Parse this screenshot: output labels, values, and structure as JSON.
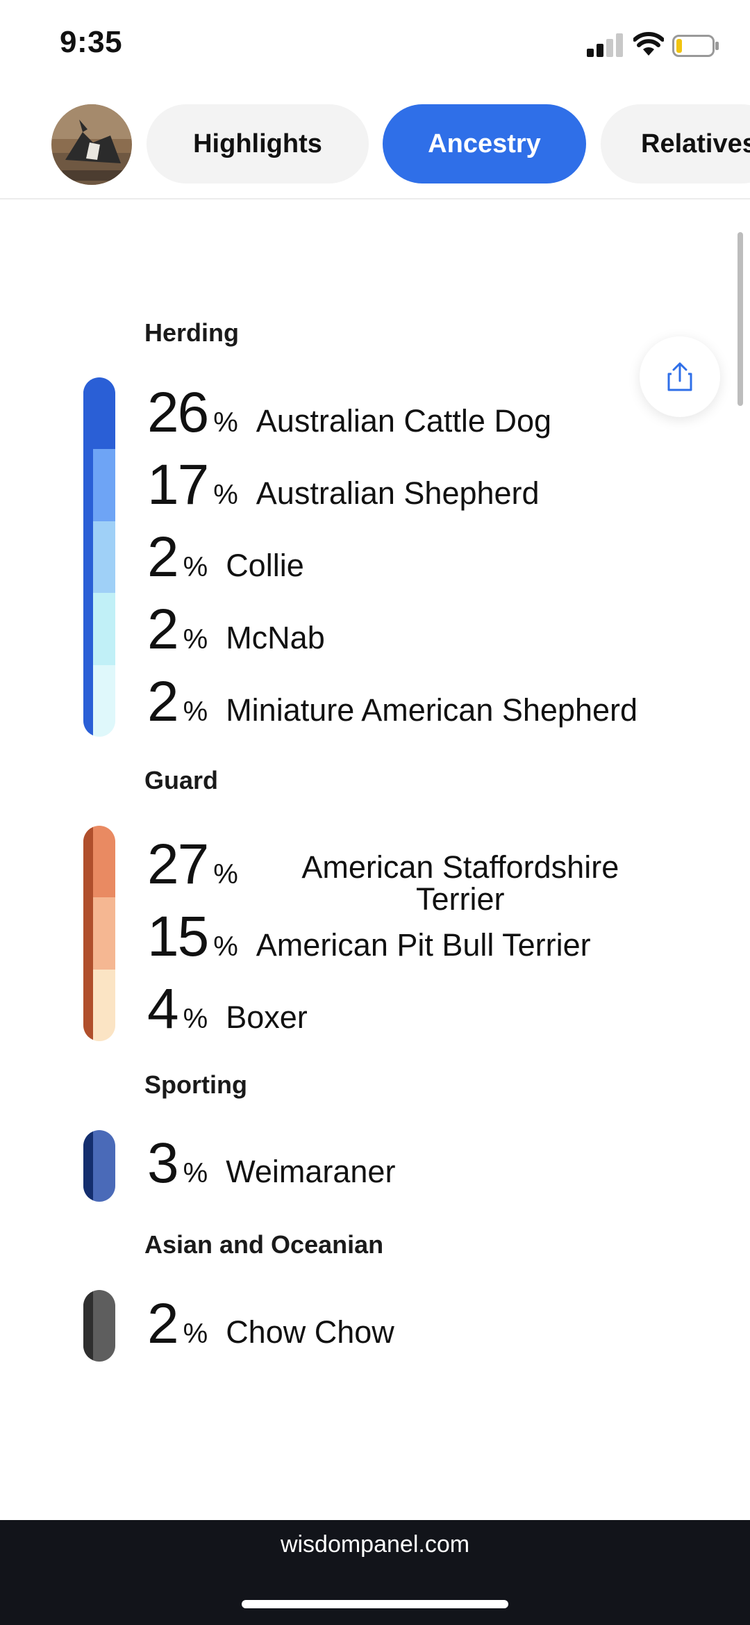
{
  "status_bar": {
    "time": "9:35"
  },
  "tabs": [
    {
      "label": "Highlights"
    },
    {
      "label": "Ancestry"
    },
    {
      "label": "Relatives"
    }
  ],
  "groups": [
    {
      "title": "Herding",
      "rows": [
        {
          "pct": "26",
          "sign": "%",
          "name": "Australian Cattle Dog"
        },
        {
          "pct": "17",
          "sign": "%",
          "name": "Australian Shepherd"
        },
        {
          "pct": "2",
          "sign": "%",
          "name": "Collie"
        },
        {
          "pct": "2",
          "sign": "%",
          "name": "McNab"
        },
        {
          "pct": "2",
          "sign": "%",
          "name": "Miniature American Shepherd"
        }
      ],
      "colors": [
        "#2a5fd6",
        "#6ea4f5",
        "#9fd0f7",
        "#c1f0f7",
        "#dff8fb"
      ]
    },
    {
      "title": "Guard",
      "rows": [
        {
          "pct": "27",
          "sign": "%",
          "name": "American Staffordshire Terrier"
        },
        {
          "pct": "15",
          "sign": "%",
          "name": "American Pit Bull Terrier"
        },
        {
          "pct": "4",
          "sign": "%",
          "name": "Boxer"
        }
      ],
      "colors": [
        "#e98a62",
        "#f5b792",
        "#fbe4c4"
      ]
    },
    {
      "title": "Sporting",
      "rows": [
        {
          "pct": "3",
          "sign": "%",
          "name": "Weimaraner"
        }
      ],
      "colors": [
        "#4a6ab8"
      ]
    },
    {
      "title": "Asian and Oceanian",
      "rows": [
        {
          "pct": "2",
          "sign": "%",
          "name": "Chow Chow"
        }
      ],
      "colors": [
        "#5e5e5e"
      ]
    }
  ],
  "footer": {
    "url": "wisdompanel.com"
  },
  "icons": {
    "share": "share-icon",
    "avatar": "dog-avatar"
  }
}
